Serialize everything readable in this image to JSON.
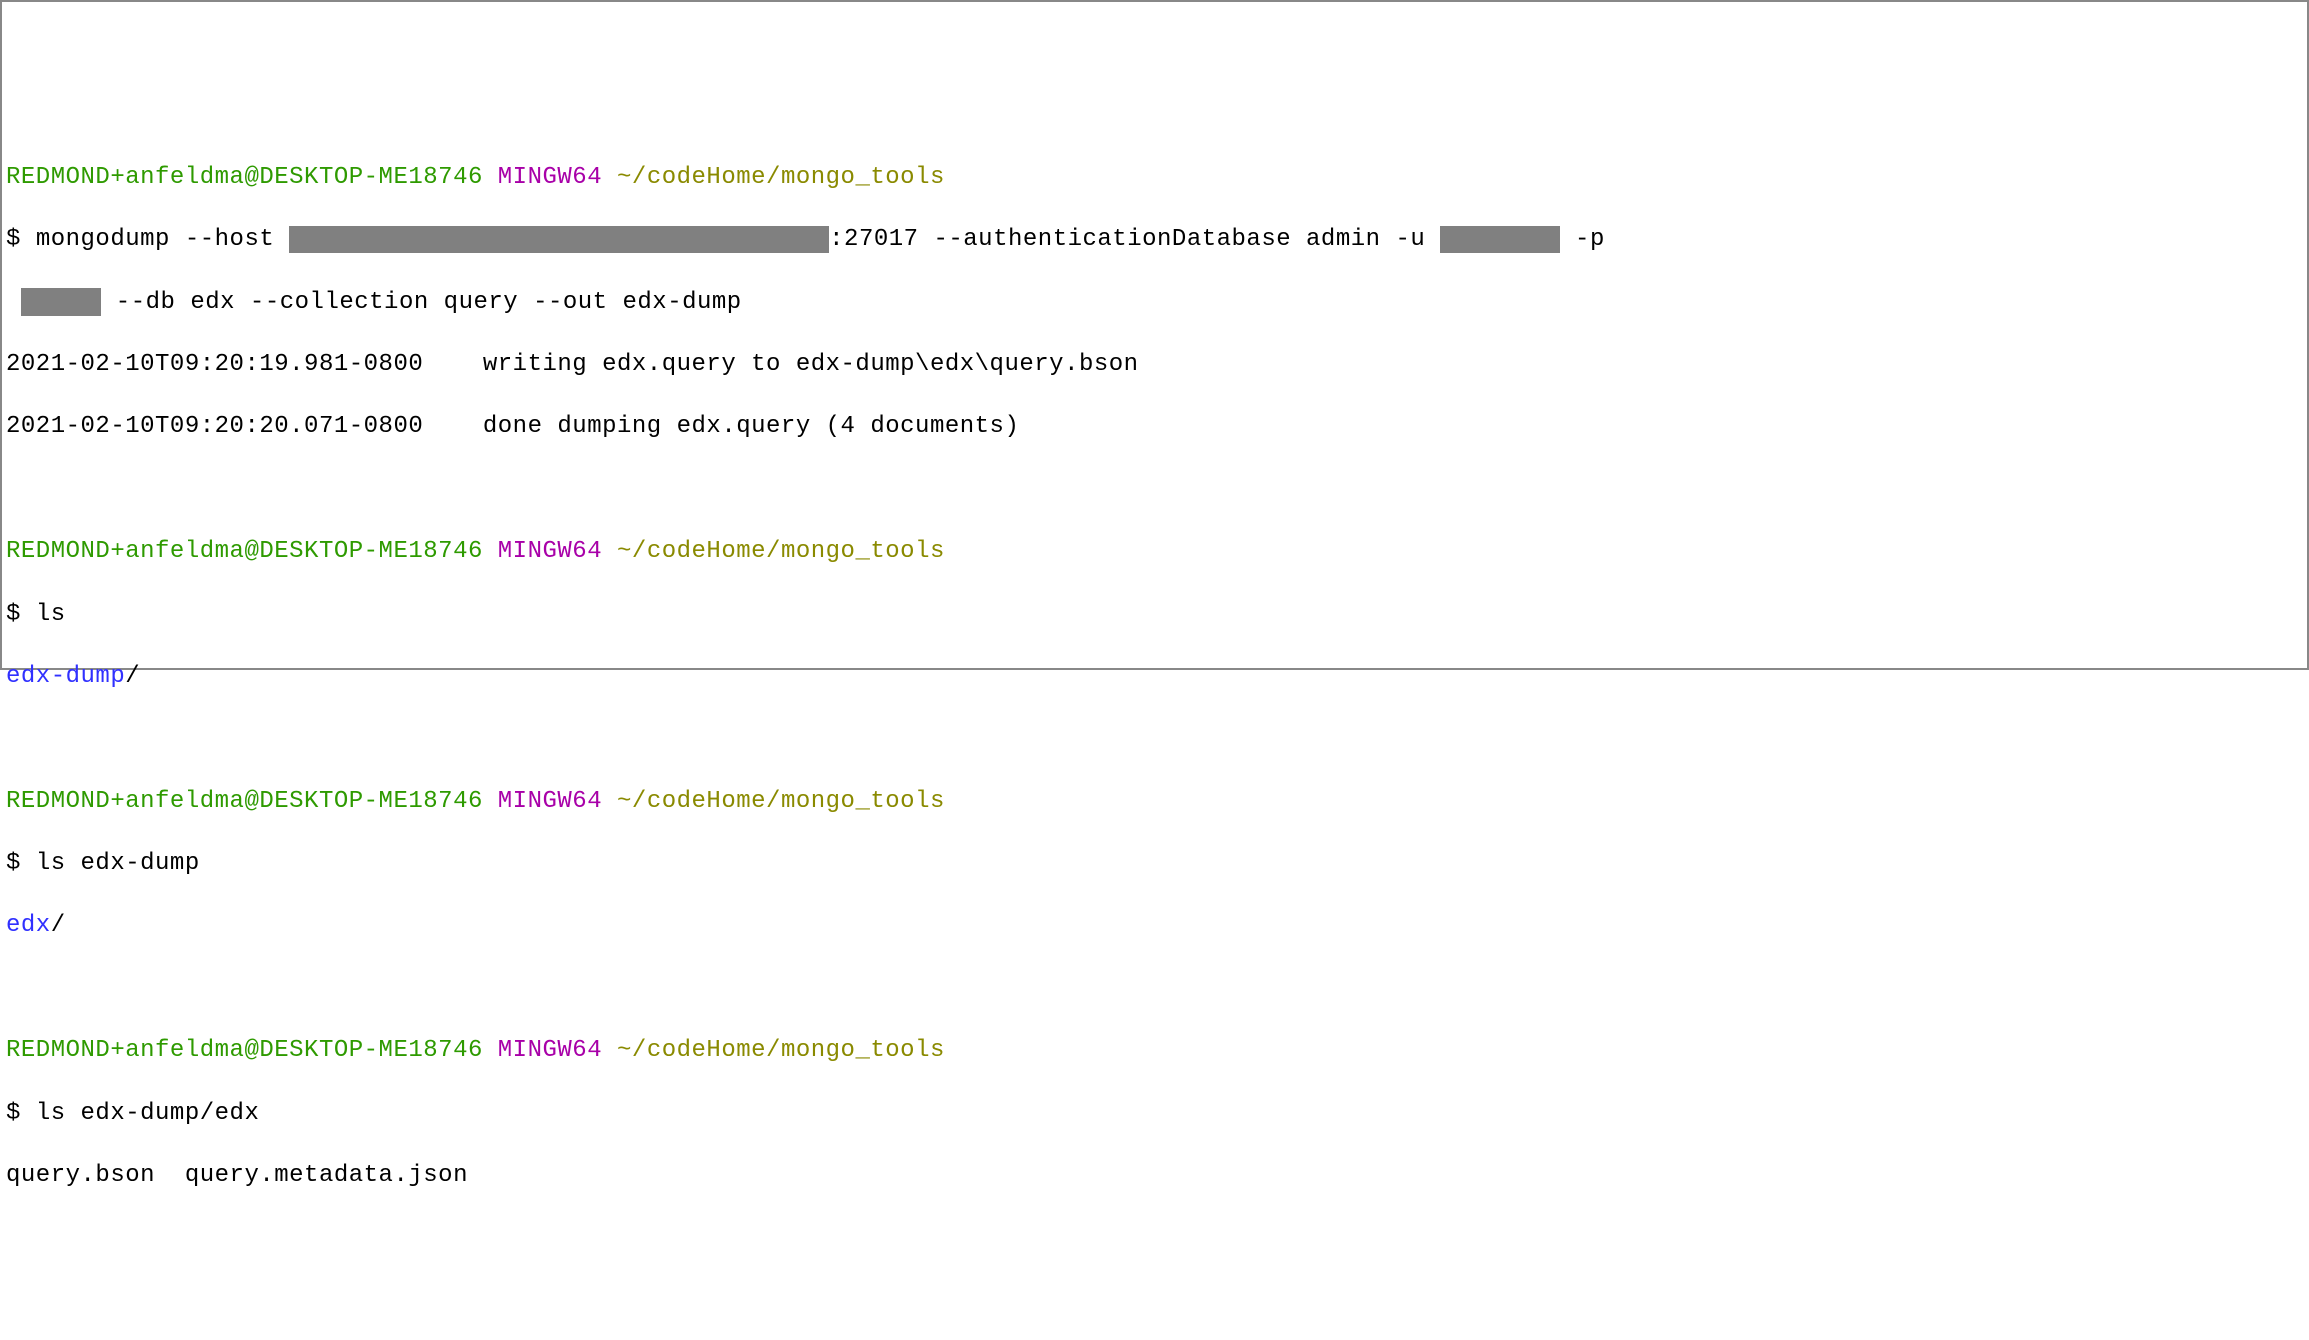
{
  "prompt": {
    "userHost": "REDMOND+anfeldma@DESKTOP-ME18746",
    "mingw": "MINGW64",
    "path": "~/codeHome/mongo_tools",
    "symbol": "$"
  },
  "sessions": [
    {
      "cmd": {
        "prefix": "mongodump --host ",
        "afterHost": ":27017 --authenticationDatabase admin -u ",
        "afterUser": " -p",
        "line2Prefix": " ",
        "afterPass": " --db edx --collection query --out edx-dump"
      },
      "output": [
        "2021-02-10T09:20:19.981-0800    writing edx.query to edx-dump\\edx\\query.bson",
        "2021-02-10T09:20:20.071-0800    done dumping edx.query (4 documents)"
      ]
    },
    {
      "cmd": "ls",
      "dirOutput": "edx-dump",
      "slash": "/"
    },
    {
      "cmd": "ls edx-dump",
      "dirOutput": "edx",
      "slash": "/"
    },
    {
      "cmd": "ls edx-dump/edx",
      "plainOutput": "query.bson  query.metadata.json"
    }
  ]
}
